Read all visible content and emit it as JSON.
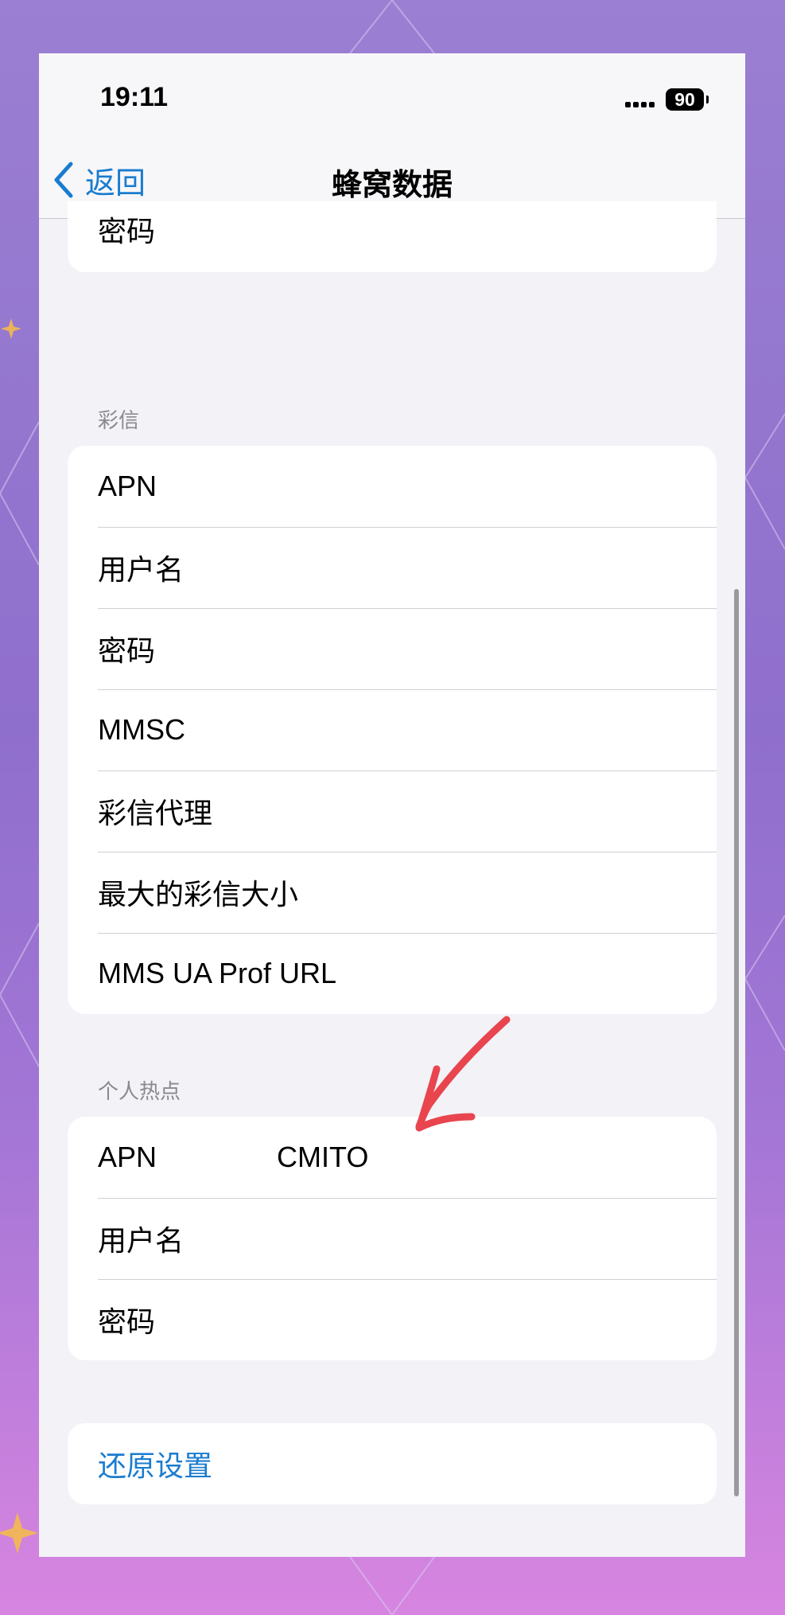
{
  "status_bar": {
    "time": "19:11",
    "battery": "90"
  },
  "nav": {
    "back_label": "返回",
    "title": "蜂窝数据"
  },
  "top_card": {
    "rows": [
      "密码"
    ]
  },
  "mms": {
    "header": "彩信",
    "rows": [
      "APN",
      "用户名",
      "密码",
      "MMSC",
      "彩信代理",
      "最大的彩信大小",
      "MMS UA Prof URL"
    ]
  },
  "hotspot": {
    "header": "个人热点",
    "rows": [
      {
        "label": "APN",
        "value": "CMITO"
      },
      {
        "label": "用户名",
        "value": ""
      },
      {
        "label": "密码",
        "value": ""
      }
    ]
  },
  "reset": {
    "label": "还原设置"
  },
  "colors": {
    "accent": "#1a7ccf",
    "annotation": "#e8454f",
    "background": "#f2f2f7"
  },
  "icons": [
    "back-chevron-icon",
    "signal-icon",
    "battery-icon",
    "arrow-annotation-icon"
  ]
}
